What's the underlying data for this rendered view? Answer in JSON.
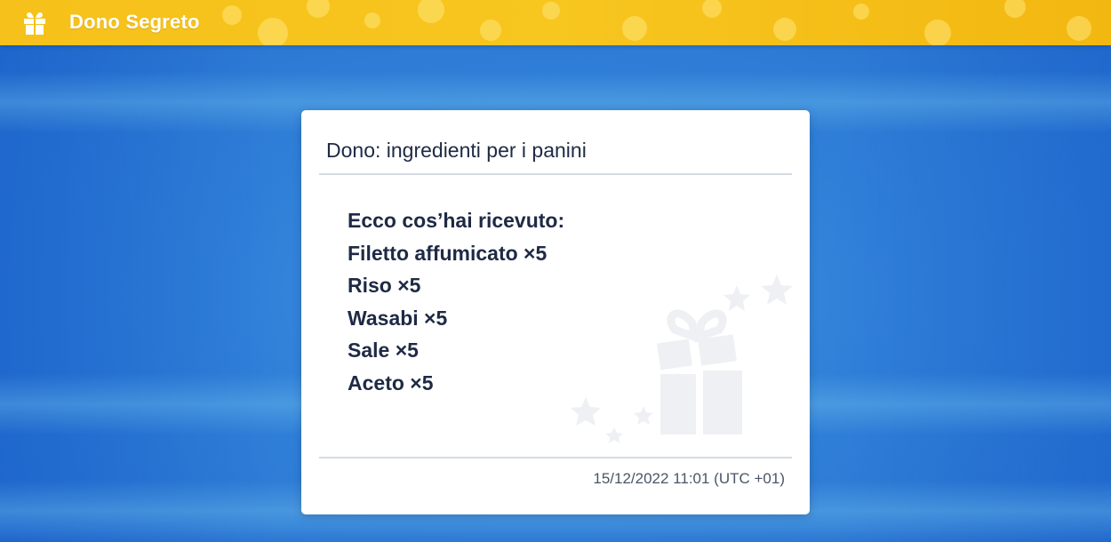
{
  "header": {
    "title": "Dono Segreto",
    "icon": "gift-icon",
    "background_color": "#f6c11a"
  },
  "dialog": {
    "title": "Dono: ingredienti per i panini",
    "intro": "Ecco cos’hai ricevuto:",
    "items": [
      "Filetto affumicato ×5",
      "Riso ×5",
      "Wasabi ×5",
      "Sale ×5",
      "Aceto ×5"
    ],
    "timestamp": "15/12/2022 11:01 (UTC +01)",
    "decoration_icon": "gift-with-stars-icon"
  },
  "colors": {
    "background": "#2f7fd8",
    "text": "#1e2a45"
  }
}
